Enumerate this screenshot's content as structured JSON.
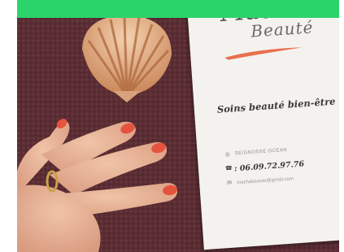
{
  "banner": {
    "color": "#2bd46a"
  },
  "card": {
    "brand_line_1": "Macha",
    "brand_line_2": "Beauté",
    "tagline": "Soins beauté bien-être",
    "address": "SEIGNOSSE OCEAN",
    "phone_prefix": ":",
    "phone": "06.09.72.97.76",
    "email": "machabeaute@gmail.com",
    "accent_color": "#e8704f"
  },
  "scene": {
    "background_color": "#5a2d33",
    "nail_color": "#e5533f",
    "shell_color": "#e0a878"
  }
}
